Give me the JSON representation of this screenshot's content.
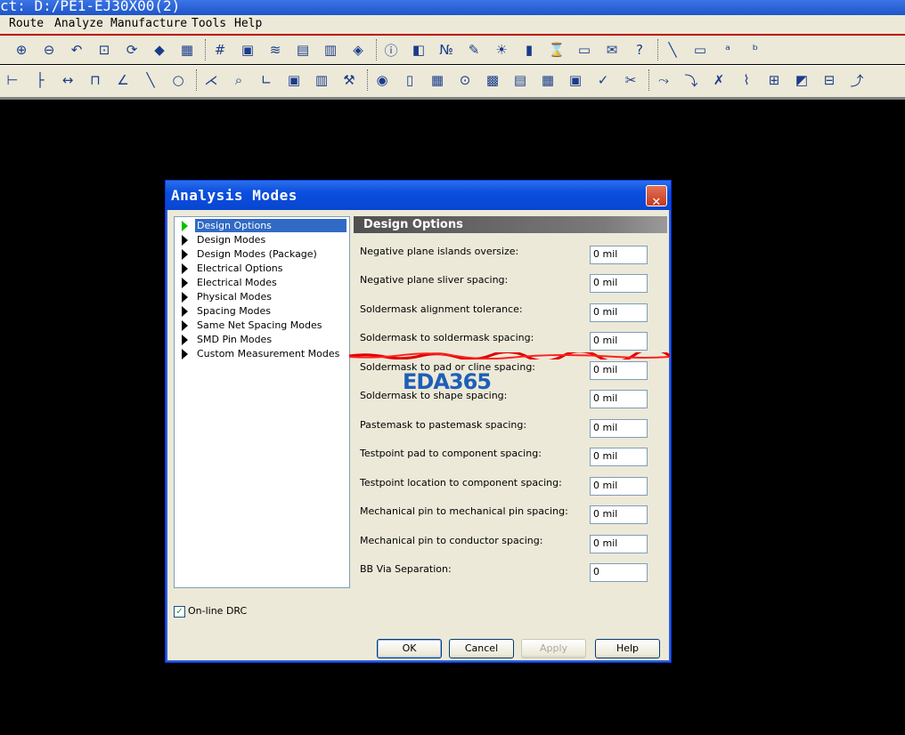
{
  "app": {
    "title_text": "ct: D:/PE1-EJ30X00(2)"
  },
  "menu": [
    {
      "label": "Route"
    },
    {
      "label": "Analyze"
    },
    {
      "label": "Manufacture"
    },
    {
      "label": "Tools"
    },
    {
      "label": "Help"
    }
  ],
  "toolbar_icons": {
    "row1": [
      "zoom-in-icon",
      "zoom-out-icon",
      "zoom-previous-icon",
      "zoom-fit-icon",
      "refresh-icon",
      "3d-view-icon",
      "flip-icon",
      "grid-icon",
      "color-icon",
      "layer-stack-icon",
      "constraint-manager-icon",
      "dfa-icon",
      "board-icon",
      "info-icon",
      "properties-icon",
      "counter-icon",
      "brush-icon",
      "sun-icon",
      "bars-icon",
      "hourglass-icon",
      "window-icon",
      "mail-icon",
      "help-icon",
      "line-icon",
      "rectangle-icon",
      "text-add-icon",
      "text-edit-icon"
    ],
    "row2": [
      "dimension-icon",
      "measure-icon",
      "width-icon",
      "ruler-icon",
      "angle-icon",
      "line-draw-icon",
      "circle-icon",
      "arc-icon",
      "search-icon",
      "tangent-icon",
      "odb-icon",
      "library-icon",
      "wrench-icon",
      "camera-icon",
      "book-icon",
      "grid-dots-icon",
      "testpoint-icon",
      "matrix-icon",
      "notes-icon",
      "report-icon",
      "package-icon",
      "check-icon",
      "cut-icon",
      "route-icon",
      "route2-icon",
      "delete-route-icon",
      "tune-icon",
      "fanout-icon",
      "shape-icon",
      "glossary-icon",
      "bus-icon"
    ]
  },
  "dialog": {
    "title": "Analysis Modes",
    "close_glyph": "✕",
    "tree": [
      {
        "label": "Design Options",
        "selected": true
      },
      {
        "label": "Design Modes"
      },
      {
        "label": "Design Modes (Package)"
      },
      {
        "label": "Electrical Options"
      },
      {
        "label": "Electrical Modes"
      },
      {
        "label": "Physical Modes"
      },
      {
        "label": "Spacing Modes"
      },
      {
        "label": "Same Net Spacing Modes"
      },
      {
        "label": "SMD Pin Modes"
      },
      {
        "label": "Custom Measurement Modes"
      }
    ],
    "panel_title": "Design Options",
    "rows": [
      {
        "label": "Negative plane islands oversize:",
        "value": "0 mil"
      },
      {
        "label": "Negative plane sliver spacing:",
        "value": "0 mil"
      },
      {
        "label": "Soldermask alignment tolerance:",
        "value": "0 mil"
      },
      {
        "label": "Soldermask to soldermask spacing:",
        "value": "0 mil"
      },
      {
        "label": "Soldermask to pad or cline spacing:",
        "value": "0 mil"
      },
      {
        "label": "Soldermask to shape spacing:",
        "value": "0 mil"
      },
      {
        "label": "Pastemask to pastemask spacing:",
        "value": "0 mil"
      },
      {
        "label": "Testpoint pad to component spacing:",
        "value": "0 mil"
      },
      {
        "label": "Testpoint location to component spacing:",
        "value": "0 mil"
      },
      {
        "label": "Mechanical pin to mechanical pin spacing:",
        "value": "0 mil"
      },
      {
        "label": "Mechanical pin to conductor spacing:",
        "value": "0 mil"
      },
      {
        "label": "BB Via Separation:",
        "value": "0"
      }
    ],
    "online_drc": {
      "label": "On-line DRC",
      "checked": true,
      "check_glyph": "✓"
    },
    "buttons": {
      "ok": "OK",
      "cancel": "Cancel",
      "apply": "Apply",
      "help": "Help"
    },
    "watermark": "EDA365"
  }
}
